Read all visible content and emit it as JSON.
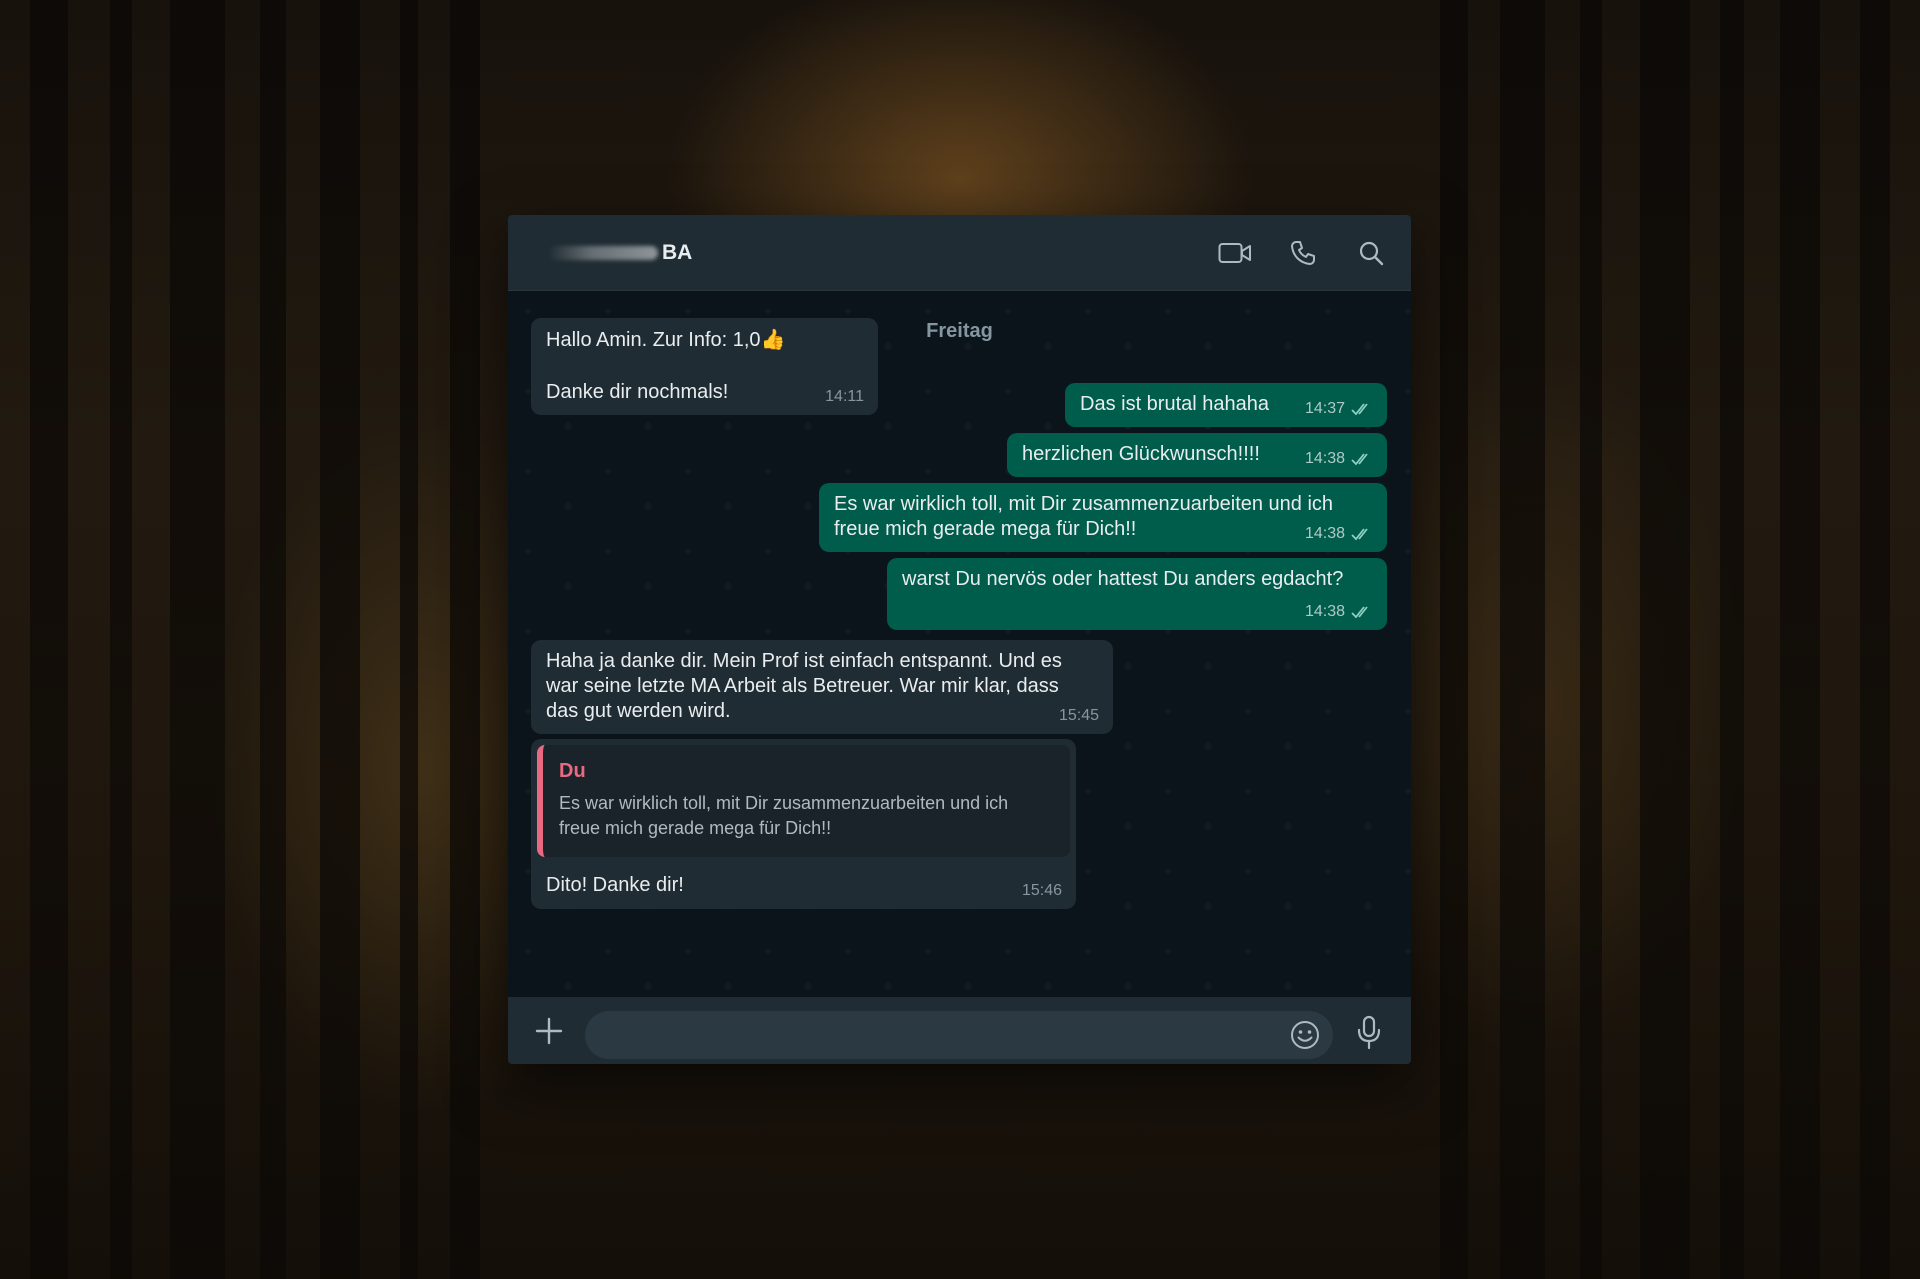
{
  "header": {
    "contact_name": "BA",
    "icons": [
      "video-call-icon",
      "phone-call-icon",
      "search-icon"
    ]
  },
  "chat": {
    "date_divider": "Freitag",
    "messages": [
      {
        "direction": "in",
        "lines": [
          "Hallo Amin. Zur Info: 1,0👍",
          "",
          "Danke dir nochmals!"
        ],
        "time": "14:11"
      },
      {
        "direction": "out",
        "lines": [
          "Das ist brutal hahaha"
        ],
        "time": "14:37",
        "status": "read"
      },
      {
        "direction": "out",
        "lines": [
          "herzlichen Glückwunsch!!!!"
        ],
        "time": "14:38",
        "status": "read"
      },
      {
        "direction": "out",
        "lines": [
          "Es war wirklich toll, mit Dir zusammenzuarbeiten und ich",
          "freue mich gerade mega für Dich!!"
        ],
        "time": "14:38",
        "status": "read"
      },
      {
        "direction": "out",
        "lines": [
          "warst Du nervös oder hattest Du anders egdacht?"
        ],
        "time": "14:38",
        "status": "read"
      },
      {
        "direction": "in",
        "lines": [
          "Haha ja danke dir. Mein Prof ist einfach entspannt. Und es",
          "war seine letzte MA Arbeit als Betreuer. War mir klar, dass",
          "das gut werden wird."
        ],
        "time": "15:45"
      },
      {
        "direction": "in",
        "quote": {
          "author": "Du",
          "text": [
            "Es war wirklich toll, mit Dir zusammenzuarbeiten und ich",
            "freue mich gerade mega für Dich!!"
          ]
        },
        "lines": [
          "Dito! Danke dir!"
        ],
        "time": "15:46"
      }
    ]
  },
  "composer": {
    "placeholder": "",
    "value": ""
  },
  "colors": {
    "outgoing_bubble": "#005c4b",
    "incoming_bubble": "#202c33",
    "quote_accent": "#e96a80",
    "header_bg": "#202c33",
    "chat_bg": "#0b141a"
  }
}
